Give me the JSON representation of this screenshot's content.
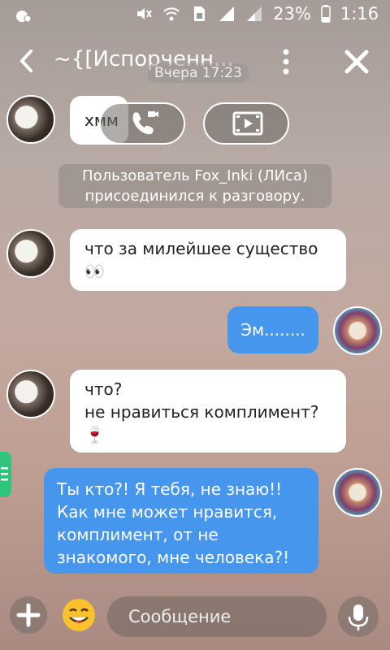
{
  "status_bar": {
    "battery": "23%",
    "time": "1:16",
    "icons": [
      "notification-icon",
      "mute-icon",
      "wifi-icon",
      "sim-icon",
      "signal-icon",
      "signal-icon",
      "battery-icon"
    ]
  },
  "header": {
    "title": "~{[Испорченн...",
    "timestamp": "Вчера 17:23"
  },
  "messages": [
    {
      "side": "other",
      "text": "хмм"
    },
    {
      "type": "system",
      "text": "Пользователь Fox_Inki (ЛИса)\nприсоединился к разговору."
    },
    {
      "side": "other",
      "text": "что за милейшее существо\n👀"
    },
    {
      "side": "me",
      "text": "Эм........"
    },
    {
      "side": "other",
      "text": "что?\nне нравиться комплимент?\n🍷"
    },
    {
      "side": "me",
      "text": "Ты кто?! Я тебя, не знаю!!\nКак мне может нравится,\nкомплимент, от не\nзнакомого, мне человека?!"
    }
  ],
  "input": {
    "placeholder": "Сообщение"
  },
  "colors": {
    "my_bubble": "#4596ec",
    "other_bubble": "#ffffff",
    "side_tab": "#30c47a"
  }
}
